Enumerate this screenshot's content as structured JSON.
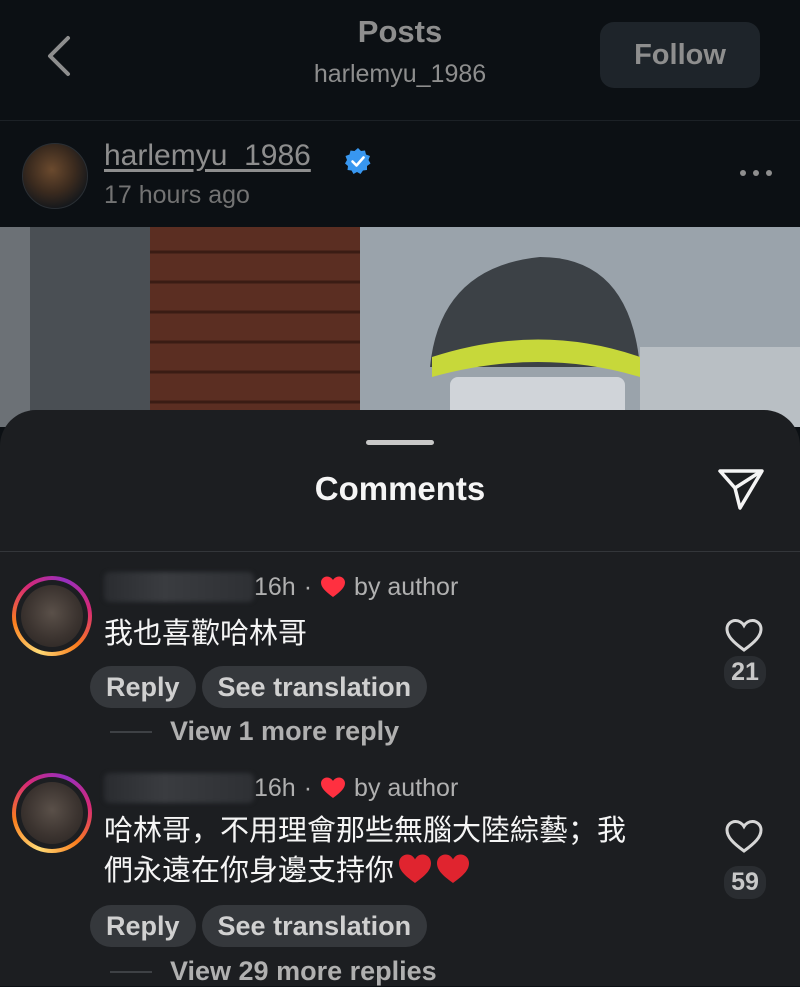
{
  "header": {
    "back_icon": "chevron-left-icon",
    "title": "Posts",
    "subtitle": "harlemyu_1986",
    "follow_label": "Follow"
  },
  "post": {
    "username": "harlemyu_1986",
    "verified_icon": "verified-badge-icon",
    "time": "17 hours ago",
    "more_icon": "more-dots-icon"
  },
  "comments_sheet": {
    "title": "Comments",
    "share_icon": "send-icon",
    "comments": [
      {
        "time": "16h",
        "separator": "·",
        "author_like_label": "by author",
        "text": "我也喜歡哈林哥",
        "reply_label": "Reply",
        "translate_label": "See translation",
        "likes": "21",
        "view_replies": "View 1 more reply"
      },
      {
        "time": "16h",
        "separator": "·",
        "author_like_label": "by author",
        "text_line1": "哈林哥，不用理會那些無腦大陸綜藝；我",
        "text_line2": "們永遠在你身邊支持你",
        "reply_label": "Reply",
        "translate_label": "See translation",
        "likes": "59",
        "view_replies": "View 29 more replies"
      }
    ]
  },
  "colors": {
    "background": "#0c1014",
    "sheet": "#1c1e21",
    "verified": "#0095f6",
    "heart": "#ff3040"
  }
}
